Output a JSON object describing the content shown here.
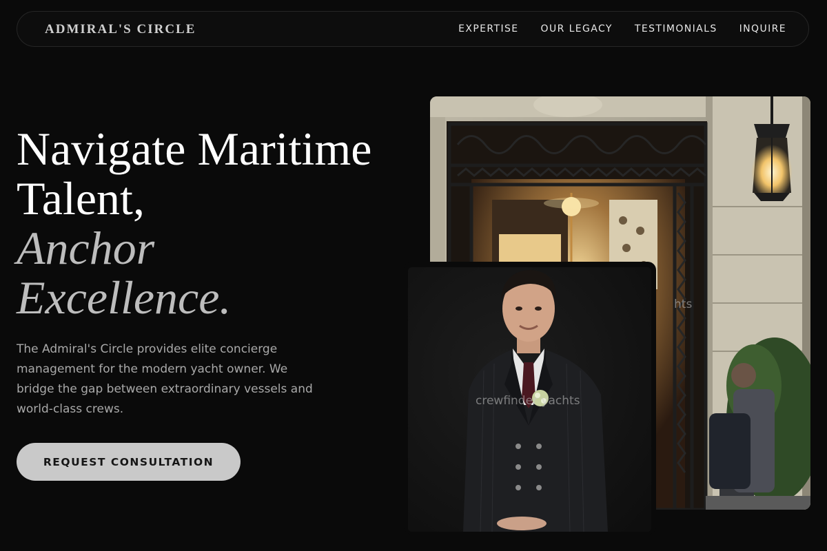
{
  "header": {
    "brand": "ADMIRAL'S CIRCLE",
    "nav": [
      {
        "label": "EXPERTISE"
      },
      {
        "label": "OUR LEGACY"
      },
      {
        "label": "TESTIMONIALS"
      },
      {
        "label": "INQUIRE"
      }
    ]
  },
  "hero": {
    "title_line1": "Navigate Maritime",
    "title_line2": "Talent,",
    "title_line3": "Anchor",
    "title_line4": "Excellence.",
    "description": "The Admiral's Circle provides elite concierge management for the modern yacht owner. We bridge the gap between extraordinary vessels and world-class crews.",
    "cta_label": "REQUEST CONSULTATION"
  },
  "images": {
    "entrance_watermark": "hts",
    "portrait_watermark": "crewfinder yachts"
  }
}
